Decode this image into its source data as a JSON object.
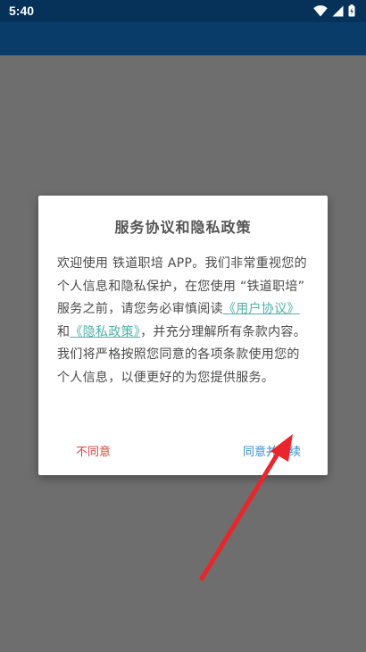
{
  "status_bar": {
    "time": "5:40",
    "icons": [
      "wifi-icon",
      "signal-icon",
      "battery-icon"
    ]
  },
  "dialog": {
    "title": "服务协议和隐私政策",
    "body": {
      "text_1": "欢迎使用 铁道职培 APP。我们非常重视您的个人信息和隐私保护，在您使用 “铁道职培” 服务之前，请您务必审慎阅读",
      "link_user_agreement": "《用户协议》",
      "text_and": "和",
      "link_privacy_policy": "《隐私政策》",
      "text_2": "，并充分理解所有条款内容。我们将严格按照您同意的各项条款使用您的个人信息，以便更好的为您提供服务。"
    },
    "disagree_label": "不同意",
    "agree_label": "同意并继续"
  },
  "colors": {
    "status_bar": "#06325a",
    "app_bar": "#0a3c6a",
    "scrim": "#6e6e6e",
    "link": "#4fb0a8",
    "disagree": "#d9453b",
    "agree": "#2f8fd2",
    "annotation_arrow": "#e8262b"
  }
}
